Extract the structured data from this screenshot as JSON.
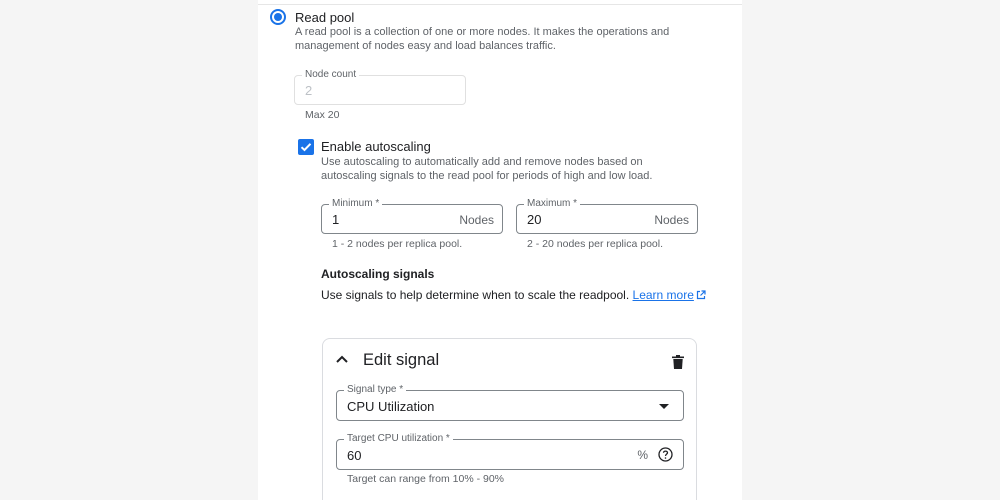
{
  "read_pool": {
    "label": "Read pool",
    "description": "A read pool is a collection of one or more nodes. It makes the operations and management of nodes easy and load balances traffic.",
    "node_count": {
      "label": "Node count",
      "value": "2",
      "hint": "Max 20"
    }
  },
  "autoscaling": {
    "checkbox_label": "Enable autoscaling",
    "checked": true,
    "description": "Use autoscaling to automatically add and remove nodes based on autoscaling signals to the read pool for periods of high and low load.",
    "minimum": {
      "label": "Minimum *",
      "value": "1",
      "suffix": "Nodes",
      "hint": "1 - 2 nodes per replica pool."
    },
    "maximum": {
      "label": "Maximum *",
      "value": "20",
      "suffix": "Nodes",
      "hint": "2 - 20 nodes per replica pool."
    }
  },
  "signals": {
    "title": "Autoscaling signals",
    "description": "Use signals to help determine when to scale the readpool.",
    "learn_more": "Learn more",
    "card": {
      "title": "Edit signal",
      "signal_type": {
        "label": "Signal type *",
        "value": "CPU Utilization"
      },
      "target": {
        "label": "Target CPU utilization *",
        "value": "60",
        "suffix": "%",
        "hint": "Target can range from 10% - 90%"
      }
    }
  },
  "colors": {
    "accent": "#1a73e8",
    "border": "#80868b",
    "muted_text": "#5f6368"
  },
  "icons": [
    "radio-selected-icon",
    "checkbox-checked-icon",
    "external-link-icon",
    "chevron-up-icon",
    "trash-icon",
    "dropdown-arrow-icon",
    "help-icon"
  ]
}
